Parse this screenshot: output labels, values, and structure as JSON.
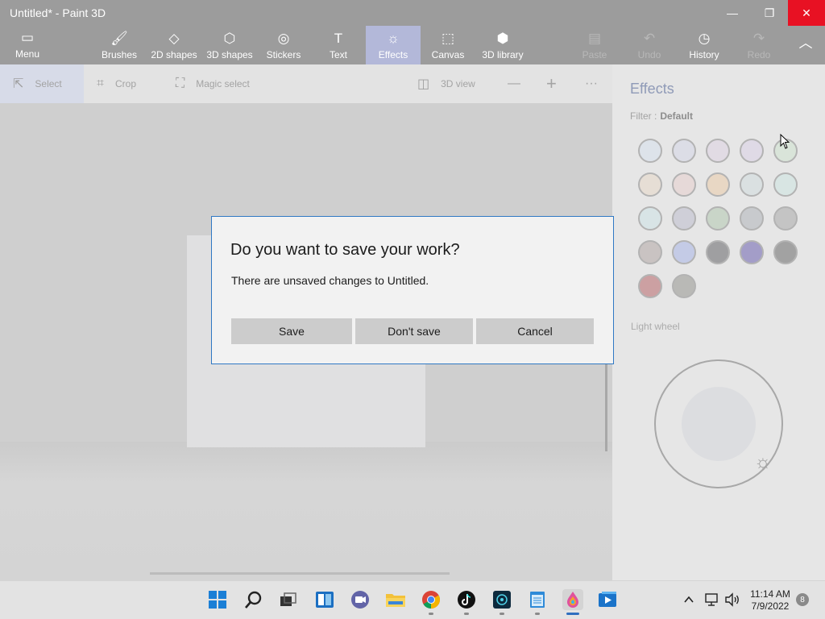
{
  "window": {
    "title": "Untitled* - Paint 3D",
    "minimize_glyph": "—",
    "maximize_glyph": "❐",
    "close_glyph": "✕"
  },
  "ribbon": {
    "menu": {
      "label": "Menu",
      "icon": "folder-icon"
    },
    "tools": [
      {
        "label": "Brushes",
        "icon": "brush-icon"
      },
      {
        "label": "2D shapes",
        "icon": "2d-shapes-icon"
      },
      {
        "label": "3D shapes",
        "icon": "3d-shapes-icon"
      },
      {
        "label": "Stickers",
        "icon": "stickers-icon"
      },
      {
        "label": "Text",
        "icon": "text-icon"
      },
      {
        "label": "Effects",
        "icon": "effects-icon",
        "active": true
      },
      {
        "label": "Canvas",
        "icon": "canvas-icon"
      },
      {
        "label": "3D library",
        "icon": "3d-library-icon"
      }
    ],
    "right": [
      {
        "label": "Paste",
        "icon": "paste-icon",
        "disabled": true
      },
      {
        "label": "Undo",
        "icon": "undo-icon",
        "disabled": true
      },
      {
        "label": "History",
        "icon": "history-icon"
      },
      {
        "label": "Redo",
        "icon": "redo-icon",
        "disabled": true
      }
    ],
    "collapse_glyph": "︿"
  },
  "toolbar": {
    "select": "Select",
    "crop": "Crop",
    "magic_select": "Magic select",
    "view_3d": "3D view",
    "zoom_out": "—",
    "zoom_in": "+",
    "more": "···"
  },
  "effects_panel": {
    "title": "Effects",
    "filter_label": "Filter :",
    "filter_value": "Default",
    "swatches": [
      "#dde3ea",
      "#dcdde6",
      "#e1dbe4",
      "#dfdae6",
      "#d9e4d9",
      "#e6ded5",
      "#e6d9d8",
      "#e8d7c4",
      "#dae0e1",
      "#d8e5e3",
      "#d8e4e6",
      "#cfcfd8",
      "#c9d5c8",
      "#c8cacd",
      "#c4c4c4",
      "#c9c3c2",
      "#c4cbe6",
      "#9f9fa1",
      "#a39dc8",
      "#a2a2a2",
      "#cca0a2",
      "#b9b9b6"
    ],
    "light_wheel_label": "Light wheel",
    "light_icon": "sun-icon"
  },
  "dialog": {
    "title": "Do you want to save your work?",
    "message": "There are unsaved changes to Untitled.",
    "save": "Save",
    "dont_save": "Don't save",
    "cancel": "Cancel",
    "accent": "#2f78c4"
  },
  "taskbar": {
    "apps": [
      {
        "name": "start-icon"
      },
      {
        "name": "search-icon"
      },
      {
        "name": "task-view-icon"
      },
      {
        "name": "widgets-icon"
      },
      {
        "name": "teams-chat-icon"
      },
      {
        "name": "file-explorer-icon"
      },
      {
        "name": "chrome-icon",
        "running": true
      },
      {
        "name": "tiktok-icon",
        "running": true
      },
      {
        "name": "game-app-icon",
        "running": true
      },
      {
        "name": "notepad-icon",
        "running": true
      },
      {
        "name": "paint-3d-icon",
        "running": true,
        "active": true
      },
      {
        "name": "media-app-icon"
      }
    ],
    "time": "11:14 AM",
    "date": "7/9/2022",
    "notifications": "8"
  }
}
